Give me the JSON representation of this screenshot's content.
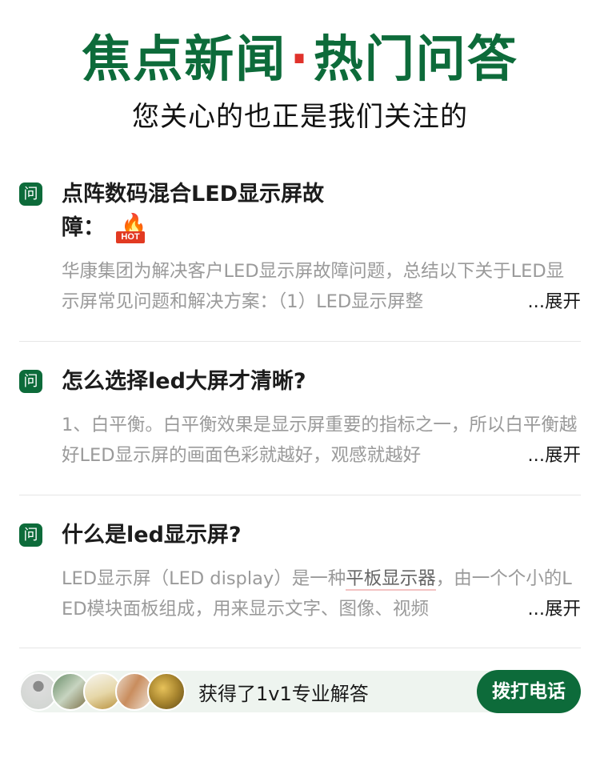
{
  "header": {
    "title_left": "焦点新闻",
    "title_dot": "·",
    "title_right": "热门问答",
    "subtitle": "您关心的也正是我们关注的"
  },
  "qa_items": [
    {
      "badge": "问",
      "question": "点阵数码混合LED显示屏故障：",
      "hot_label": "HOT",
      "answer": "华康集团为解决客户LED显示屏故障问题，总结以下关于LED显示屏常见问题和解决方案：（1）LED显示屏整",
      "expand_label": "...展开"
    },
    {
      "badge": "问",
      "question": "怎么选择led大屏才清晰?",
      "answer": "1、白平衡。白平衡效果是显示屏重要的指标之一，所以白平衡越好LED显示屏的画面色彩就越好，观感就越好",
      "expand_label": "...展开"
    },
    {
      "badge": "问",
      "question": "什么是led显示屏?",
      "answer_pre": "LED显示屏（LED display）是一种",
      "answer_link": "平板显示器",
      "answer_post": "，由一个个小的LED模块面板组成，用来显示文字、图像、视频",
      "expand_label": "...展开"
    }
  ],
  "bottom_bar": {
    "text": "获得了1v1专业解答",
    "call_label": "拨打电话"
  },
  "colors": {
    "brand_green": "#0d6b3a",
    "dot_red": "#e0322b",
    "answer_gray": "#9a9a9a"
  }
}
